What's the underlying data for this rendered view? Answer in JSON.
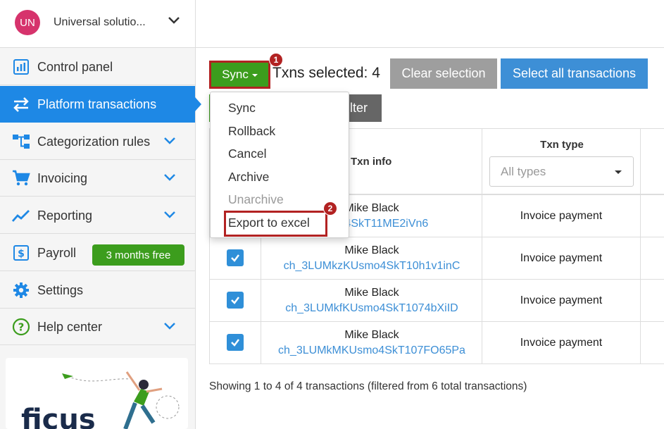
{
  "organization": {
    "initials": "UN",
    "name": "Universal solutio..."
  },
  "sidebar": {
    "items": [
      {
        "label": "Control panel",
        "icon": "bar-chart-icon",
        "chevron": false
      },
      {
        "label": "Platform transactions",
        "icon": "transfer-arrows-icon",
        "chevron": false,
        "active": true
      },
      {
        "label": "Categorization rules",
        "icon": "hierarchy-icon",
        "chevron": true
      },
      {
        "label": "Invoicing",
        "icon": "cart-icon",
        "chevron": true
      },
      {
        "label": "Reporting",
        "icon": "trend-line-icon",
        "chevron": true
      },
      {
        "label": "Payroll",
        "icon": "dollar-card-icon",
        "chevron": false,
        "badge": "3 months free"
      },
      {
        "label": "Settings",
        "icon": "gear-icon",
        "chevron": false
      },
      {
        "label": "Help center",
        "icon": "help-circle-icon",
        "chevron": true
      }
    ],
    "promo_logo": "ficus"
  },
  "toolbar": {
    "sync_label": "Sync",
    "selected_text": "Txns selected: 4",
    "clear_label": "Clear selection",
    "select_all_label": "Select all transactions",
    "filter_label": "ilter",
    "markers": [
      "1",
      "2"
    ]
  },
  "dropdown": {
    "items": [
      {
        "label": "Sync",
        "disabled": false
      },
      {
        "label": "Rollback",
        "disabled": false
      },
      {
        "label": "Cancel",
        "disabled": false
      },
      {
        "label": "Archive",
        "disabled": false
      },
      {
        "label": "Unarchive",
        "disabled": true
      },
      {
        "label": "Export to excel",
        "disabled": false
      }
    ]
  },
  "table": {
    "headers": {
      "info": "Txn info",
      "type": "Txn type"
    },
    "type_filter_placeholder": "All types",
    "rows": [
      {
        "name": "Mike Black",
        "id": "Usmo4SkT11ME2iVn6",
        "type": "Invoice payment",
        "checked": true
      },
      {
        "name": "Mike Black",
        "id": "ch_3LUMkzKUsmo4SkT10h1v1inC",
        "type": "Invoice payment",
        "checked": true
      },
      {
        "name": "Mike Black",
        "id": "ch_3LUMkfKUsmo4SkT1074bXiID",
        "type": "Invoice payment",
        "checked": true
      },
      {
        "name": "Mike Black",
        "id": "ch_3LUMkMKUsmo4SkT107FO65Pa",
        "type": "Invoice payment",
        "checked": true
      }
    ]
  },
  "footer": {
    "showing": "Showing 1 to 4 of 4 transactions (filtered from 6 total transactions)"
  },
  "colors": {
    "accent": "#1e88e5",
    "green": "#3c9d1d",
    "highlight": "#b22222",
    "link": "#3d8fd6"
  }
}
